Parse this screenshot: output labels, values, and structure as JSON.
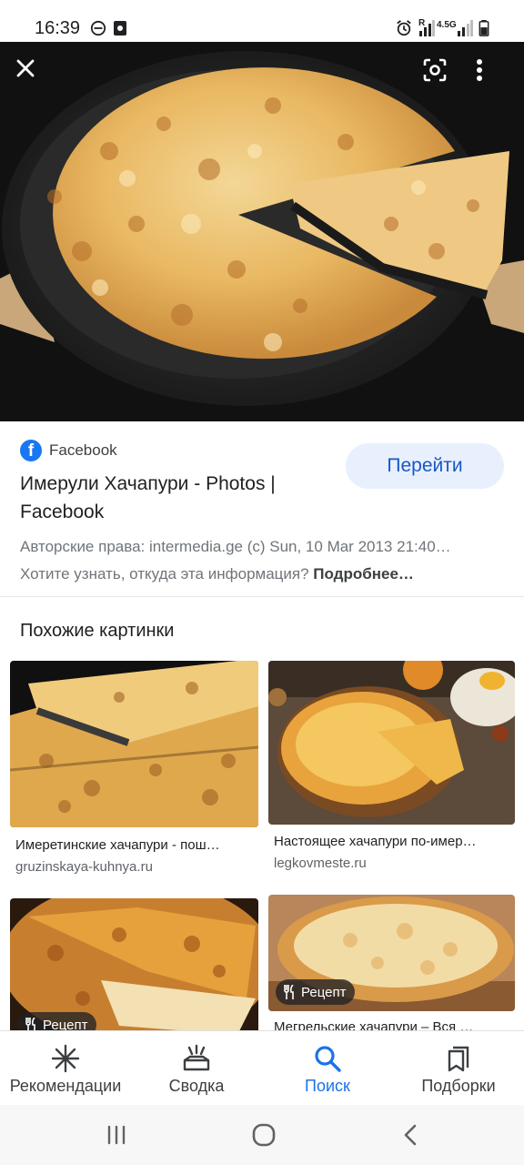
{
  "status_bar": {
    "time": "16:39",
    "network": "4.5G",
    "roaming": "R"
  },
  "viewer": {
    "close_icon": "close-icon",
    "lens_icon": "google-lens-icon",
    "menu_icon": "more-vert-icon"
  },
  "result": {
    "source_name": "Facebook",
    "title": "Имерули Хачапури - Photos | Facebook",
    "visit_label": "Перейти",
    "copyright": "Авторские права: intermedia.ge (c) Sun, 10 Mar 2013 21:40…",
    "info_question": "Хотите узнать, откуда эта информация?",
    "info_link": "Подробнее…"
  },
  "related": {
    "heading": "Похожие картинки",
    "items": [
      {
        "caption": "Имеретинские хачапури - пош…",
        "domain": "gruzinskaya-kuhnya.ru",
        "badge": ""
      },
      {
        "caption": "Настоящее хачапури по-имер…",
        "domain": "legkovmeste.ru",
        "badge": ""
      },
      {
        "caption": "",
        "domain": "",
        "badge": "Рецепт"
      },
      {
        "caption": "Мегрельские хачапури – Вся …",
        "domain": "",
        "badge": "Рецепт"
      }
    ]
  },
  "bottom_nav": {
    "items": [
      {
        "label": "Рекомендации",
        "icon": "asterisk-icon",
        "active": false
      },
      {
        "label": "Сводка",
        "icon": "updates-icon",
        "active": false
      },
      {
        "label": "Поиск",
        "icon": "search-icon",
        "active": true
      },
      {
        "label": "Подборки",
        "icon": "collections-icon",
        "active": false
      }
    ]
  },
  "colors": {
    "accent": "#1a73e8",
    "visit_button_bg": "#e8f0fe",
    "facebook": "#1877f2"
  }
}
